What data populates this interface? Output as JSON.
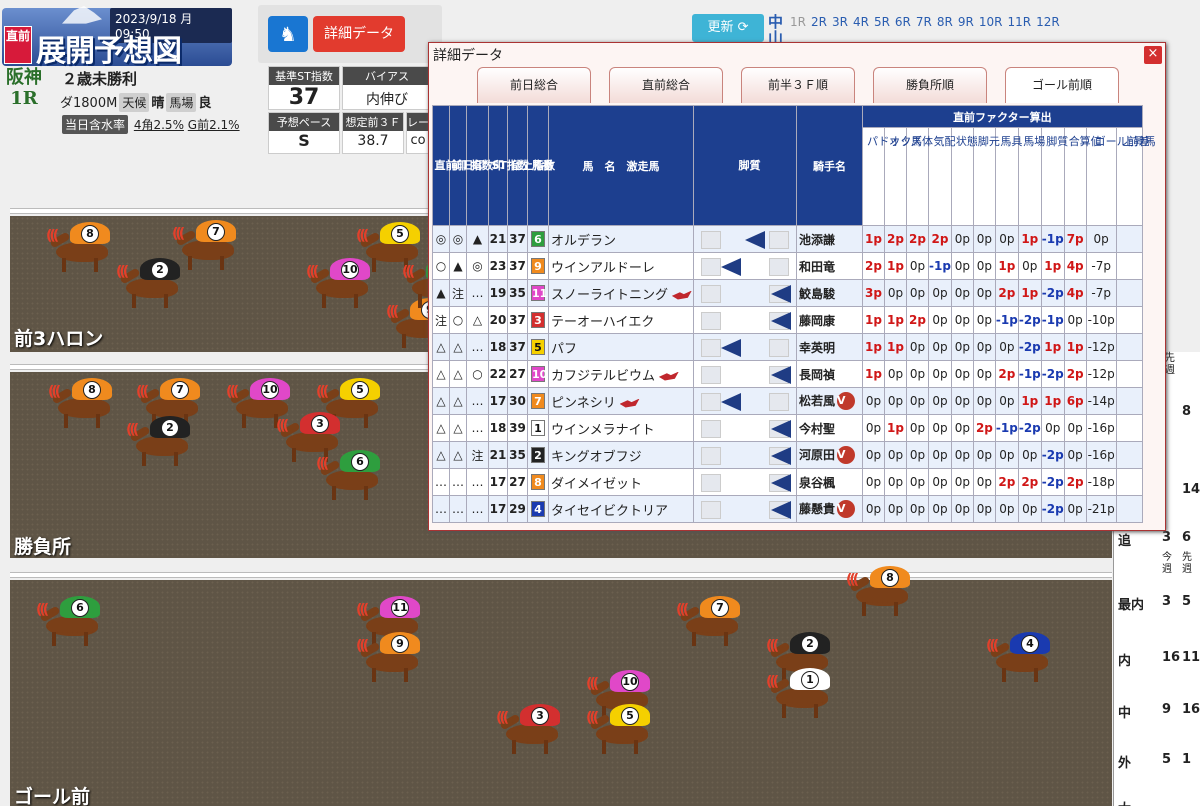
{
  "header": {
    "date": "2023/9/18",
    "weekday": "月",
    "time": "09:50",
    "logo_badge": "直前",
    "logo_title": "展開予想図",
    "venue": "阪神",
    "race_no": "1R",
    "race_name": "２歳未勝利",
    "distance": "ダ1800M",
    "weather_label": "天候",
    "weather": "晴",
    "track_label": "馬場",
    "track_cond": "良",
    "moisture_label": "当日含水率",
    "moist1": "4角2.5%",
    "moist2": "G前2.1%",
    "detail_button": "詳細データ"
  },
  "index": {
    "st_label": "基準ST指数",
    "st_value": "37",
    "bias_label": "バイアス",
    "bias_value": "内伸び",
    "pace_label": "予想ペース",
    "pace_value": "S",
    "front3f_label": "想定前３Ｆ",
    "front3f_value": "38.7",
    "lane_label": "レー",
    "lane_value": "co"
  },
  "nav": {
    "update_label": "更新",
    "center_label": "中",
    "center_label2": "山",
    "races": [
      "1R",
      "2R",
      "3R",
      "4R",
      "5R",
      "6R",
      "7R",
      "8R",
      "9R",
      "10R",
      "11R",
      "12R"
    ]
  },
  "tracks": {
    "t1": "前3ハロン",
    "t2": "勝負所",
    "t3": "ゴール前"
  },
  "dialog": {
    "title": "詳細データ",
    "close": "×",
    "tabs": [
      "前日総合",
      "直前総合",
      "前半３Ｆ順",
      "勝負所順",
      "ゴール前順"
    ],
    "factor_group": "直前ファクター算出",
    "headers": {
      "h1": "直前印",
      "h2": "前日印",
      "h3": "指数印",
      "h4": "ST指数",
      "h5": "仕上指数",
      "h6": "馬番",
      "h7": "馬　名　激走馬",
      "h8": "脚質",
      "h9": "騎手名",
      "f": [
        "パドック",
        "オッズ",
        "馬体",
        "気配",
        "状態",
        "脚元",
        "馬具",
        "馬場",
        "脚質",
        "合算値",
        "ゴール前差",
        "上昇馬"
      ]
    },
    "rows": [
      {
        "m1": "◎",
        "m2": "◎",
        "m3": "▲",
        "st": "21",
        "sh": "37",
        "no": "6",
        "name": "オルデラン",
        "fire": false,
        "jockey": "池添謙",
        "v": false,
        "f": [
          "1p",
          "2p",
          "2p",
          "2p",
          "0p",
          "0p",
          "0p",
          "1p",
          "-1p",
          "7p",
          "0p"
        ],
        "leg": 0
      },
      {
        "m1": "○",
        "m2": "▲",
        "m3": "◎",
        "st": "23",
        "sh": "37",
        "no": "9",
        "name": "ウインアルドーレ",
        "fire": false,
        "jockey": "和田竜",
        "v": false,
        "f": [
          "2p",
          "1p",
          "0p",
          "-1p",
          "0p",
          "0p",
          "1p",
          "0p",
          "1p",
          "4p",
          "-7p"
        ],
        "leg": 1
      },
      {
        "m1": "▲",
        "m2": "注",
        "m3": "…",
        "st": "19",
        "sh": "35",
        "no": "11",
        "name": "スノーライトニング",
        "fire": true,
        "jockey": "鮫島駿",
        "v": false,
        "f": [
          "3p",
          "0p",
          "0p",
          "0p",
          "0p",
          "0p",
          "2p",
          "1p",
          "-2p",
          "4p",
          "-7p"
        ],
        "leg": 2
      },
      {
        "m1": "注",
        "m2": "○",
        "m3": "△",
        "st": "20",
        "sh": "37",
        "no": "3",
        "name": "テーオーハイエク",
        "fire": false,
        "jockey": "藤岡康",
        "v": false,
        "f": [
          "1p",
          "1p",
          "2p",
          "0p",
          "0p",
          "0p",
          "-1p",
          "-2p",
          "-1p",
          "0p",
          "-10p"
        ],
        "leg": 2
      },
      {
        "m1": "△",
        "m2": "△",
        "m3": "…",
        "st": "18",
        "sh": "37",
        "no": "5",
        "name": "パフ",
        "fire": false,
        "jockey": "幸英明",
        "v": false,
        "f": [
          "1p",
          "1p",
          "0p",
          "0p",
          "0p",
          "0p",
          "0p",
          "-2p",
          "1p",
          "1p",
          "-12p"
        ],
        "leg": 1
      },
      {
        "m1": "△",
        "m2": "△",
        "m3": "○",
        "st": "22",
        "sh": "27",
        "no": "10",
        "name": "カフジテルビウム",
        "fire": true,
        "jockey": "長岡禎",
        "v": false,
        "f": [
          "1p",
          "0p",
          "0p",
          "0p",
          "0p",
          "0p",
          "2p",
          "-1p",
          "-2p",
          "2p",
          "-12p"
        ],
        "leg": 2
      },
      {
        "m1": "△",
        "m2": "△",
        "m3": "…",
        "st": "17",
        "sh": "30",
        "no": "7",
        "name": "ピンネシリ",
        "fire": true,
        "jockey": "松若風",
        "v": true,
        "f": [
          "0p",
          "0p",
          "0p",
          "0p",
          "0p",
          "0p",
          "0p",
          "1p",
          "1p",
          "6p",
          "-14p"
        ],
        "leg": 1
      },
      {
        "m1": "△",
        "m2": "△",
        "m3": "…",
        "st": "18",
        "sh": "39",
        "no": "1",
        "name": "ウインメラナイト",
        "fire": false,
        "jockey": "今村聖",
        "v": false,
        "f": [
          "0p",
          "1p",
          "0p",
          "0p",
          "0p",
          "2p",
          "-1p",
          "-2p",
          "0p",
          "0p",
          "-16p"
        ],
        "leg": 2
      },
      {
        "m1": "△",
        "m2": "△",
        "m3": "注",
        "st": "21",
        "sh": "35",
        "no": "2",
        "name": "キングオブフジ",
        "fire": false,
        "jockey": "河原田",
        "v": true,
        "f": [
          "0p",
          "0p",
          "0p",
          "0p",
          "0p",
          "0p",
          "0p",
          "0p",
          "-2p",
          "0p",
          "-16p"
        ],
        "leg": 2
      },
      {
        "m1": "…",
        "m2": "…",
        "m3": "…",
        "st": "17",
        "sh": "27",
        "no": "8",
        "name": "ダイメイゼット",
        "fire": false,
        "jockey": "泉谷楓",
        "v": false,
        "f": [
          "0p",
          "0p",
          "0p",
          "0p",
          "0p",
          "0p",
          "2p",
          "2p",
          "-2p",
          "2p",
          "-18p"
        ],
        "leg": 2
      },
      {
        "m1": "…",
        "m2": "…",
        "m3": "…",
        "st": "17",
        "sh": "29",
        "no": "4",
        "name": "タイセイビクトリア",
        "fire": false,
        "jockey": "藤懸貴",
        "v": true,
        "f": [
          "0p",
          "0p",
          "0p",
          "0p",
          "0p",
          "0p",
          "0p",
          "0p",
          "-2p",
          "0p",
          "-21p"
        ],
        "leg": 2
      }
    ]
  },
  "rside": {
    "head": "先週",
    "rows": [
      {
        "label": "",
        "a": "",
        "b": "8"
      },
      {
        "label": "",
        "a": "",
        "b": "14"
      },
      {
        "label": "追",
        "a": "3",
        "b": "6"
      },
      {
        "label": "",
        "a": "今週",
        "b": "先週"
      },
      {
        "label": "最内",
        "a": "3",
        "b": "5"
      },
      {
        "label": "内",
        "a": "16",
        "b": "11"
      },
      {
        "label": "中",
        "a": "9",
        "b": "16"
      },
      {
        "label": "外",
        "a": "5",
        "b": "1"
      },
      {
        "label": "大",
        "a": "",
        "b": ""
      }
    ]
  },
  "colors": {
    "post1": "#ffffff",
    "post2": "#222222",
    "post3": "#d32f2f",
    "post4": "#1a3ab0",
    "post5": "#f5d000",
    "post6": "#2e9e3e",
    "post7": "#f08a1e",
    "post8": "#f08a1e",
    "post9": "#f08a1e",
    "post10": "#e048c8",
    "post11": "#e048c8"
  }
}
